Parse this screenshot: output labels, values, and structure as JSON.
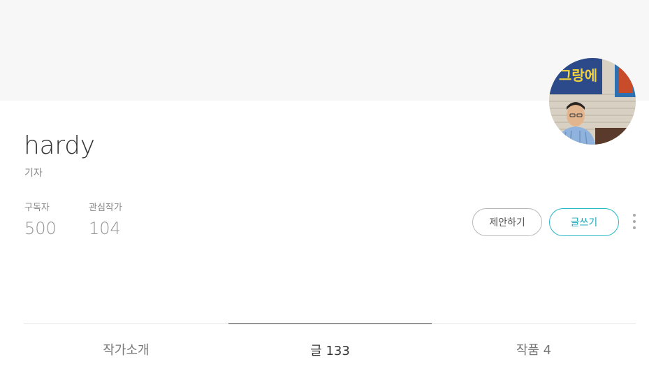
{
  "profile": {
    "name": "hardy",
    "role": "기자",
    "avatar_sign_text": "그랑에"
  },
  "stats": {
    "subscribers_label": "구독자",
    "subscribers_value": "500",
    "following_label": "관심작가",
    "following_value": "104"
  },
  "actions": {
    "suggest_label": "제안하기",
    "write_label": "글쓰기"
  },
  "tabs": [
    {
      "label": "작가소개",
      "active": false
    },
    {
      "label": "글 133",
      "active": true
    },
    {
      "label": "작품 4",
      "active": false
    }
  ],
  "colors": {
    "accent": "#27b8c8",
    "cover_bg": "#f7f7f7"
  }
}
